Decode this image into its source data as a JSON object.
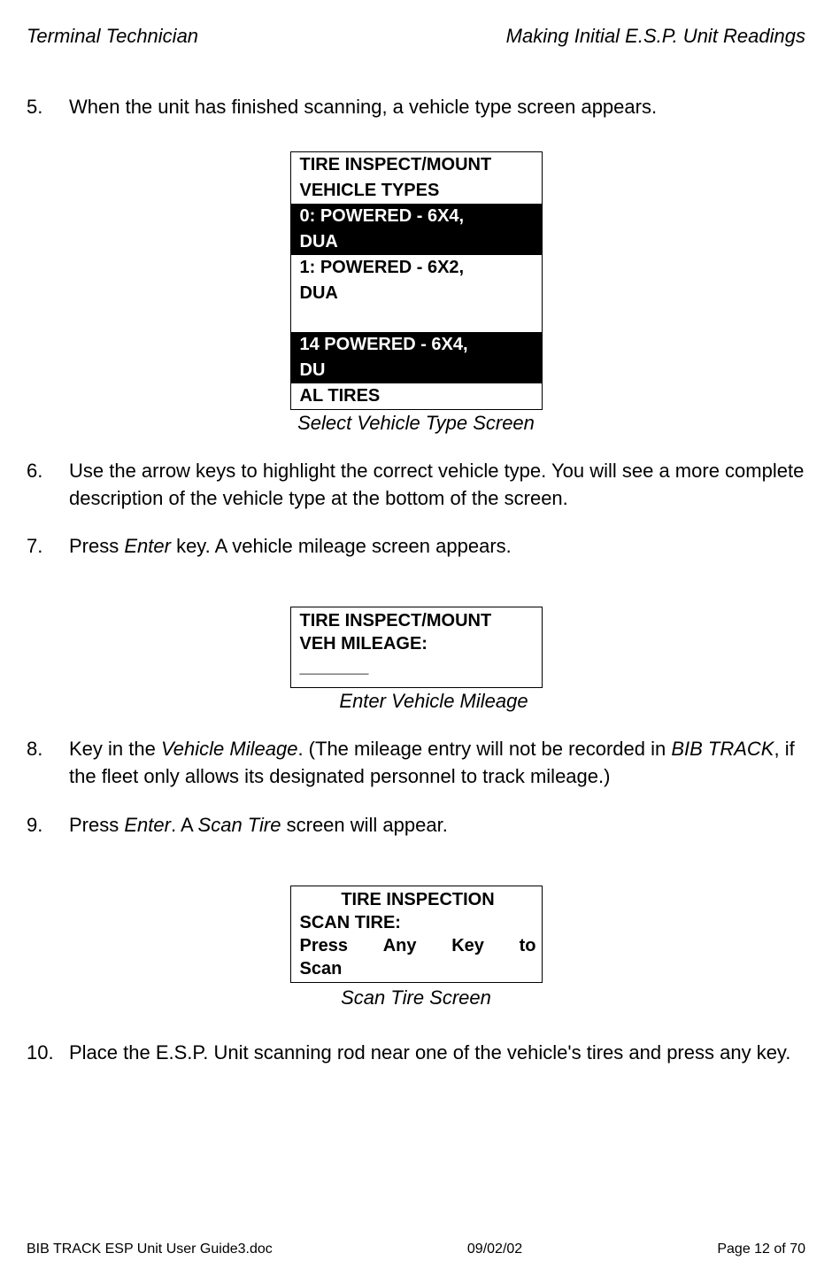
{
  "header": {
    "left": "Terminal Technician",
    "right": "Making Initial E.S.P. Unit Readings"
  },
  "steps": {
    "s5": {
      "num": "5.",
      "text": "When the unit has finished scanning, a vehicle type screen appears."
    },
    "s6": {
      "num": "6.",
      "text": "Use the arrow keys to highlight the correct vehicle type.  You will see a more complete description of the vehicle type at the bottom of the screen."
    },
    "s7": {
      "num": "7.",
      "text_a": "Press ",
      "em_a": "Enter",
      "text_b": " key. A vehicle mileage screen appears."
    },
    "s8": {
      "num": "8.",
      "text_a": "Key in the ",
      "em_a": "Vehicle Mileage",
      "text_b": ".  (The mileage entry will not be recorded in ",
      "em_b": "BIB TRACK",
      "text_c": ", if the fleet only allows its designated personnel to track mileage.)"
    },
    "s9": {
      "num": "9.",
      "text_a": "Press ",
      "em_a": "Enter",
      "text_b": ".  A ",
      "em_b": "Scan Tire",
      "text_c": " screen will appear."
    },
    "s10": {
      "num": "10.",
      "text": "Place the E.S.P. Unit scanning rod near one of the vehicle's tires and press any key."
    }
  },
  "vehicle_screen": {
    "line1": "TIRE INSPECT/MOUNT",
    "line2": "VEHICLE TYPES",
    "opt0a": "0: POWERED - 6X4,",
    "opt0b": "DUA",
    "opt1a": "1: POWERED - 6X2,",
    "opt1b": "DUA",
    "opt14a": "14 POWERED - 6X4,",
    "opt14b": "DU",
    "lastline": "AL TIRES",
    "caption": "Select Vehicle Type Screen"
  },
  "mileage_screen": {
    "line1": "TIRE INSPECT/MOUNT",
    "line2": "VEH MILEAGE:",
    "blank": "_______",
    "caption": "Enter Vehicle Mileage"
  },
  "scan_screen": {
    "line1": "TIRE INSPECTION",
    "line2": "SCAN TIRE:",
    "press_words": [
      "Press",
      "Any",
      "Key",
      "to"
    ],
    "line4": "Scan",
    "caption": "Scan Tire Screen"
  },
  "footer": {
    "left": "BIB TRACK  ESP Unit User Guide3.doc",
    "center": "09/02/02",
    "right": "Page 12 of 70"
  }
}
